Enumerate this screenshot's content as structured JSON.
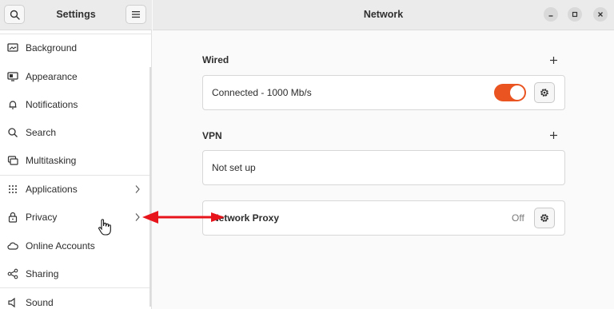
{
  "sidebar": {
    "title": "Settings",
    "items": [
      {
        "label": "Background",
        "icon": "background-icon",
        "chevron": false
      },
      {
        "label": "Appearance",
        "icon": "appearance-icon",
        "chevron": false
      },
      {
        "label": "Notifications",
        "icon": "bell-icon",
        "chevron": false
      },
      {
        "label": "Search",
        "icon": "search-icon",
        "chevron": false
      },
      {
        "label": "Multitasking",
        "icon": "multitasking-icon",
        "chevron": false
      },
      {
        "label": "Applications",
        "icon": "applications-grid-icon",
        "chevron": true
      },
      {
        "label": "Privacy",
        "icon": "lock-icon",
        "chevron": true
      },
      {
        "label": "Online Accounts",
        "icon": "cloud-icon",
        "chevron": false
      },
      {
        "label": "Sharing",
        "icon": "share-icon",
        "chevron": false
      },
      {
        "label": "Sound",
        "icon": "speaker-icon",
        "chevron": false
      }
    ]
  },
  "main": {
    "title": "Network",
    "wired": {
      "title": "Wired",
      "status": "Connected - 1000 Mb/s",
      "toggle_on": true
    },
    "vpn": {
      "title": "VPN",
      "status": "Not set up"
    },
    "proxy": {
      "label": "Network Proxy",
      "status": "Off"
    }
  },
  "colors": {
    "accent": "#e95420",
    "annotation_arrow": "#e8141b"
  }
}
